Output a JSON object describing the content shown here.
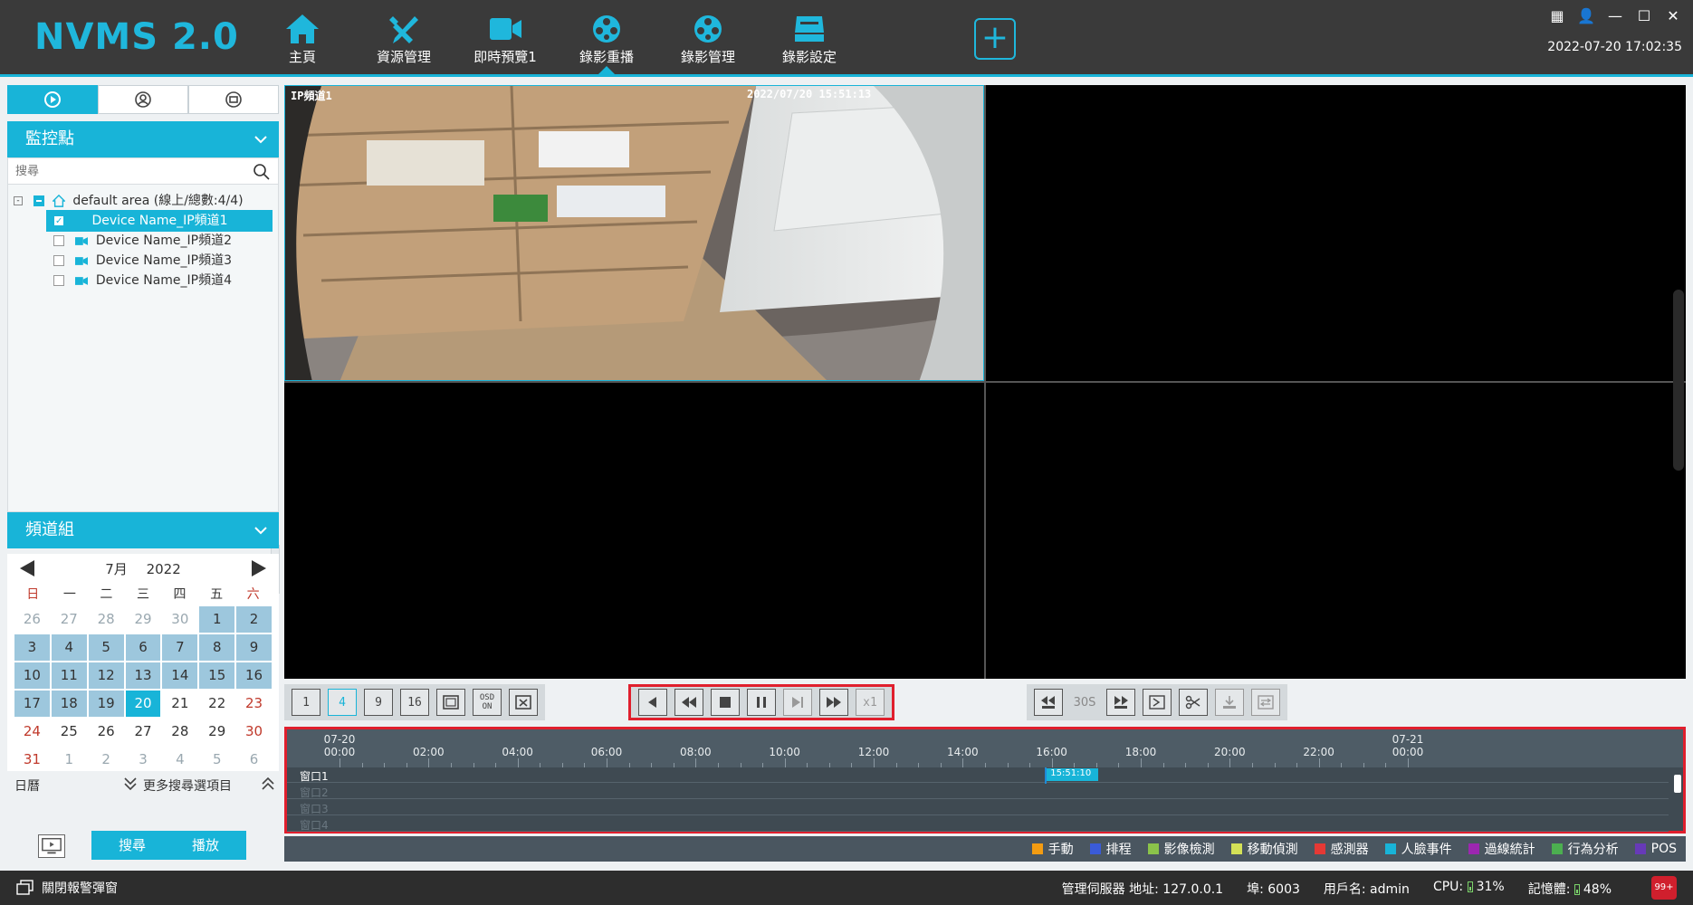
{
  "app": {
    "title": "NVMS 2.0"
  },
  "nav": {
    "items": [
      {
        "label": "主頁",
        "icon": "home-icon"
      },
      {
        "label": "資源管理",
        "icon": "tools-icon"
      },
      {
        "label": "即時預覽1",
        "icon": "camera-icon"
      },
      {
        "label": "錄影重播",
        "icon": "film-reel-icon",
        "active": true
      },
      {
        "label": "錄影管理",
        "icon": "film-reel-icon"
      },
      {
        "label": "錄影設定",
        "icon": "recorder-icon"
      }
    ],
    "add": "+"
  },
  "clock": "2022-07-20 17:02:35",
  "left": {
    "monitor_title": "監控點",
    "search_placeholder": "搜尋",
    "tree": {
      "root": "default area (線上/總數:4/4)",
      "devices": [
        "Device Name_IP頻道1",
        "Device Name_IP頻道2",
        "Device Name_IP頻道3",
        "Device Name_IP頻道4"
      ]
    },
    "group_title": "頻道組",
    "calendar": {
      "month": "7月",
      "year": "2022",
      "weekdays": [
        "日",
        "一",
        "二",
        "三",
        "四",
        "五",
        "六"
      ],
      "days": [
        [
          "26",
          "27",
          "28",
          "29",
          "30",
          "1",
          "2"
        ],
        [
          "3",
          "4",
          "5",
          "6",
          "7",
          "8",
          "9"
        ],
        [
          "10",
          "11",
          "12",
          "13",
          "14",
          "15",
          "16"
        ],
        [
          "17",
          "18",
          "19",
          "20",
          "21",
          "22",
          "23"
        ],
        [
          "24",
          "25",
          "26",
          "27",
          "28",
          "29",
          "30"
        ],
        [
          "31",
          "1",
          "2",
          "3",
          "4",
          "5",
          "6"
        ]
      ],
      "today": "20"
    },
    "calendar_label": "日曆",
    "more_search": "更多搜尋選項目",
    "search_button": "搜尋",
    "play_button": "播放"
  },
  "video": {
    "cam1_name": "IP頻道1",
    "cam1_time": "2022/07/20 15:51:13"
  },
  "toolbar": {
    "split1": "1",
    "split4": "4",
    "split9": "9",
    "split16": "16",
    "osd": "OSD ON",
    "speed": "x1",
    "jump": "30S"
  },
  "timeline": {
    "start_date": "07-20",
    "end_date": "07-21",
    "hours": [
      "00:00",
      "02:00",
      "04:00",
      "06:00",
      "08:00",
      "10:00",
      "12:00",
      "14:00",
      "16:00",
      "18:00",
      "20:00",
      "22:00",
      "00:00"
    ],
    "windows": [
      "窗口1",
      "窗口2",
      "窗口3",
      "窗口4"
    ],
    "segment_label": "15:51:10",
    "segment_start_hour": 15.85,
    "segment_end_hour": 17.05
  },
  "legend": [
    {
      "label": "手動",
      "color": "#f39c12"
    },
    {
      "label": "排程",
      "color": "#3a5bd9"
    },
    {
      "label": "影像檢測",
      "color": "#8bc34a"
    },
    {
      "label": "移動偵測",
      "color": "#d4e157"
    },
    {
      "label": "感測器",
      "color": "#e53935"
    },
    {
      "label": "人臉事件",
      "color": "#18b4d8"
    },
    {
      "label": "過線統計",
      "color": "#9c27b0"
    },
    {
      "label": "行為分析",
      "color": "#4caf50"
    },
    {
      "label": "POS",
      "color": "#673ab7"
    }
  ],
  "status": {
    "close_alarm": "關閉報警彈窗",
    "server": "管理伺服器 地址: 127.0.0.1",
    "port": "埠: 6003",
    "user": "用戶名: admin",
    "cpu": "CPU:",
    "cpu_val": "31%",
    "mem": "記憶體:",
    "mem_val": "48%",
    "badge": "99+"
  },
  "colors": {
    "accent": "#18b4d8",
    "highlight": "#e01f2d"
  }
}
